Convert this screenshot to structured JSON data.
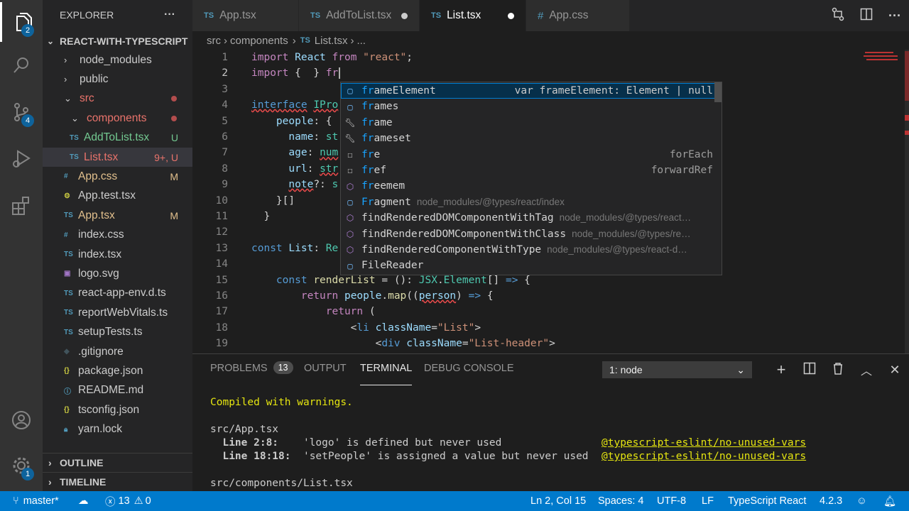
{
  "activity_bar": {
    "explorer_badge": "2",
    "scm_badge": "4",
    "settings_badge": "1"
  },
  "explorer": {
    "title": "EXPLORER",
    "more": "···",
    "root": "REACT-WITH-TYPESCRIPT",
    "items": [
      {
        "label": "node_modules",
        "status": ""
      },
      {
        "label": "public",
        "status": ""
      },
      {
        "label": "src",
        "status": ""
      },
      {
        "label": "components",
        "status": ""
      },
      {
        "label": "AddToList.tsx",
        "status": "U"
      },
      {
        "label": "List.tsx",
        "status": "9+, U"
      },
      {
        "label": "App.css",
        "status": "M"
      },
      {
        "label": "App.test.tsx",
        "status": ""
      },
      {
        "label": "App.tsx",
        "status": "M"
      },
      {
        "label": "index.css",
        "status": ""
      },
      {
        "label": "index.tsx",
        "status": ""
      },
      {
        "label": "logo.svg",
        "status": ""
      },
      {
        "label": "react-app-env.d.ts",
        "status": ""
      },
      {
        "label": "reportWebVitals.ts",
        "status": ""
      },
      {
        "label": "setupTests.ts",
        "status": ""
      },
      {
        "label": ".gitignore",
        "status": ""
      },
      {
        "label": "package.json",
        "status": ""
      },
      {
        "label": "README.md",
        "status": ""
      },
      {
        "label": "tsconfig.json",
        "status": ""
      },
      {
        "label": "yarn.lock",
        "status": ""
      }
    ],
    "outline": "OUTLINE",
    "timeline": "TIMELINE"
  },
  "tabs": [
    {
      "prefix": "TS",
      "label": "App.tsx"
    },
    {
      "prefix": "TS",
      "label": "AddToList.tsx"
    },
    {
      "prefix": "TS",
      "label": "List.tsx"
    },
    {
      "prefix": "#",
      "label": "App.css"
    }
  ],
  "breadcrumb": {
    "part1": "src",
    "part2": "components",
    "prefix": "TS",
    "file": "List.tsx",
    "rest": "..."
  },
  "line_numbers": [
    "1",
    "2",
    "3",
    "4",
    "5",
    "6",
    "7",
    "8",
    "9",
    "10",
    "11",
    "12",
    "13",
    "14",
    "15",
    "16",
    "17",
    "18",
    "19"
  ],
  "suggestions": [
    {
      "match": "fr",
      "rest": "ameElement",
      "detail": "var frameElement: Element | null",
      "path": ""
    },
    {
      "match": "fr",
      "rest": "ames",
      "detail": "",
      "path": ""
    },
    {
      "match": "fr",
      "rest": "ame",
      "detail": "",
      "path": ""
    },
    {
      "match": "fr",
      "rest": "ameset",
      "detail": "",
      "path": ""
    },
    {
      "match": "fr",
      "rest": "e",
      "detail": "forEach",
      "path": ""
    },
    {
      "match": "fr",
      "rest": "ef",
      "detail": "forwardRef",
      "path": ""
    },
    {
      "match": "fr",
      "rest": "eemem",
      "detail": "",
      "path": ""
    },
    {
      "match": "Fr",
      "rest": "agment",
      "detail": "",
      "path": "node_modules/@types/react/index"
    },
    {
      "match": "",
      "rest": "findRenderedDOMComponentWithTag",
      "detail": "",
      "path": "node_modules/@types/react…"
    },
    {
      "match": "",
      "rest": "findRenderedDOMComponentWithClass",
      "detail": "",
      "path": "node_modules/@types/re…"
    },
    {
      "match": "",
      "rest": "findRenderedComponentWithType",
      "detail": "",
      "path": "node_modules/@types/react-d…"
    },
    {
      "match": "",
      "rest": "FileReader",
      "detail": "",
      "path": ""
    }
  ],
  "panel": {
    "problems": "PROBLEMS",
    "problems_count": "13",
    "output": "OUTPUT",
    "terminal": "TERMINAL",
    "debug": "DEBUG CONSOLE",
    "terminal_select": "1: node",
    "lines": {
      "compiled": "Compiled with warnings.",
      "file1": "src/App.tsx",
      "w1_loc": "  Line 2:8:",
      "w1_msg": "    'logo' is defined but never used",
      "w1_rule": "@typescript-eslint/no-unused-vars",
      "w2_loc": "  Line 18:18:",
      "w2_msg": "  'setPeople' is assigned a value but never used",
      "w2_rule": "@typescript-eslint/no-unused-vars",
      "file2": "src/components/List.tsx"
    }
  },
  "status": {
    "branch": "master*",
    "errors": "13",
    "warnings": "0",
    "position": "Ln 2, Col 15",
    "spaces": "Spaces: 4",
    "encoding": "UTF-8",
    "eol": "LF",
    "language": "TypeScript React",
    "version": "4.2.3"
  }
}
